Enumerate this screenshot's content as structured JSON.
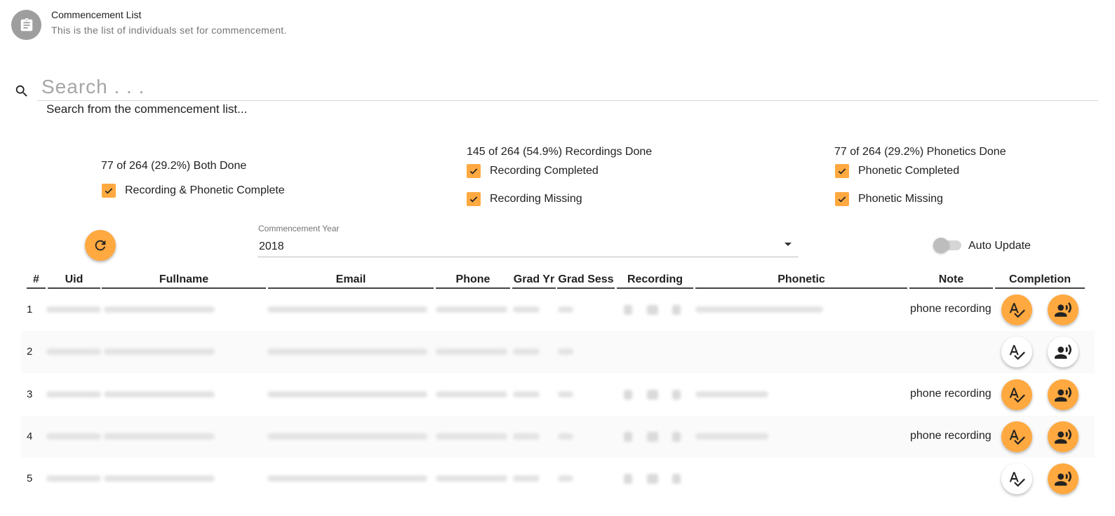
{
  "header": {
    "title": "Commencement List",
    "subtitle": "This is the list of individuals set for commencement.",
    "icon": "clipboard-icon"
  },
  "search": {
    "placeholder": "Search . . .",
    "value": "",
    "hint": "Search from the commencement list..."
  },
  "stats": {
    "both_done": "77 of 264 (29.2%) Both Done",
    "recordings_done": "145 of 264 (54.9%) Recordings Done",
    "phonetics_done": "77 of 264 (29.2%) Phonetics Done"
  },
  "filters": {
    "recording_phonetic_complete": {
      "label": "Recording & Phonetic Complete",
      "checked": true
    },
    "recording_completed": {
      "label": "Recording Completed",
      "checked": true
    },
    "recording_missing": {
      "label": "Recording Missing",
      "checked": true
    },
    "phonetic_completed": {
      "label": "Phonetic Completed",
      "checked": true
    },
    "phonetic_missing": {
      "label": "Phonetic Missing",
      "checked": true
    }
  },
  "controls": {
    "year_label": "Commencement Year",
    "year_value": "2018",
    "auto_update_label": "Auto Update",
    "auto_update_on": false
  },
  "table": {
    "columns": [
      "#",
      "Uid",
      "Fullname",
      "Email",
      "Phone",
      "Grad Yr",
      "Grad Sess",
      "Recording",
      "Phonetic",
      "Note",
      "Completion"
    ],
    "rows": [
      {
        "num": "1",
        "note": "phone recording",
        "phonetic_done": true,
        "recording_done": true
      },
      {
        "num": "2",
        "note": "",
        "phonetic_done": false,
        "recording_done": false
      },
      {
        "num": "3",
        "note": "phone recording",
        "phonetic_done": true,
        "recording_done": true
      },
      {
        "num": "4",
        "note": "phone recording",
        "phonetic_done": true,
        "recording_done": true
      },
      {
        "num": "5",
        "note": "",
        "phonetic_done": false,
        "recording_done": true
      }
    ]
  },
  "colors": {
    "accent": "#ffa940",
    "header_line": "#444444",
    "muted": "#757575"
  }
}
